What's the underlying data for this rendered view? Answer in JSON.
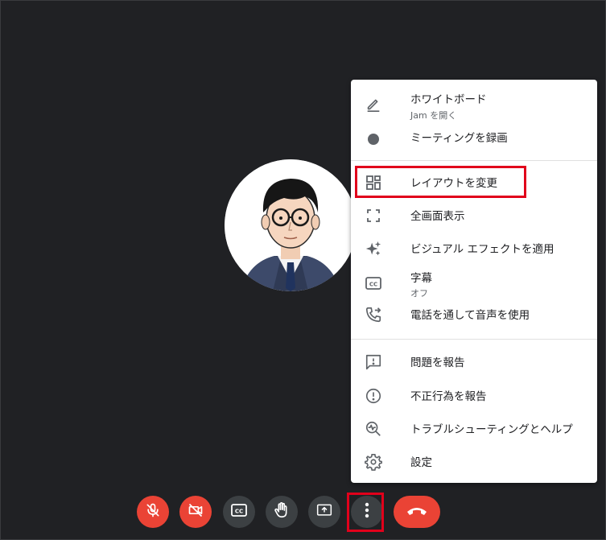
{
  "menu": {
    "items": [
      {
        "label": "ホワイトボード",
        "sub": "Jam を開く",
        "icon": "pencil-icon"
      },
      {
        "label": "ミーティングを録画",
        "icon": "record-icon"
      },
      {
        "label": "レイアウトを変更",
        "icon": "layout-icon"
      },
      {
        "label": "全画面表示",
        "icon": "fullscreen-icon"
      },
      {
        "label": "ビジュアル エフェクトを適用",
        "icon": "sparkle-icon"
      },
      {
        "label": "字幕",
        "sub": "オフ",
        "icon": "cc-icon"
      },
      {
        "label": "電話を通して音声を使用",
        "icon": "phone-forward-icon"
      },
      {
        "label": "問題を報告",
        "icon": "feedback-icon"
      },
      {
        "label": "不正行為を報告",
        "icon": "alert-circle-icon"
      },
      {
        "label": "トラブルシューティングとヘルプ",
        "icon": "troubleshoot-icon"
      },
      {
        "label": "設定",
        "icon": "gear-icon"
      }
    ]
  },
  "toolbar": {
    "buttons": [
      {
        "name": "mic-off-button",
        "icon": "mic-off-icon",
        "color": "#ea4335"
      },
      {
        "name": "camera-off-button",
        "icon": "camera-off-icon",
        "color": "#ea4335"
      },
      {
        "name": "captions-button",
        "icon": "cc-icon",
        "color": "#3c4043"
      },
      {
        "name": "raise-hand-button",
        "icon": "hand-icon",
        "color": "#3c4043"
      },
      {
        "name": "present-button",
        "icon": "present-icon",
        "color": "#3c4043"
      },
      {
        "name": "more-options-button",
        "icon": "more-vert-icon",
        "color": "#3c4043"
      },
      {
        "name": "end-call-button",
        "icon": "end-call-icon",
        "color": "#ea4335"
      }
    ]
  },
  "colors": {
    "background": "#202124",
    "highlight": "#e1001b",
    "menu_icon": "#5f6368"
  }
}
